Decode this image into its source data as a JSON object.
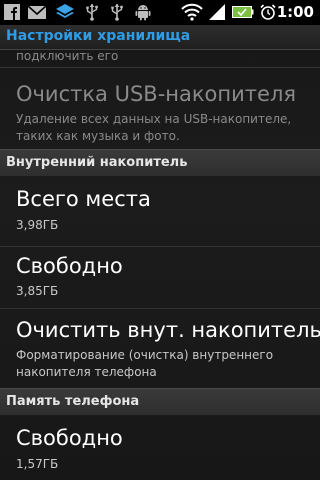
{
  "status_bar": {
    "time": "1:00",
    "icons": [
      "facebook-icon",
      "gmail-icon",
      "sync-icon",
      "usb-icon",
      "usb-icon",
      "android-icon",
      "wifi-icon",
      "battery-icon",
      "alarm-icon"
    ]
  },
  "title_bar": {
    "title": "Настройки хранилища"
  },
  "list": {
    "partial_summary": "подключить его",
    "clear_usb": {
      "title": "Очистка USB-накопителя",
      "summary_line1": "Удаление всех данных на USB-накопителе,",
      "summary_line2": "таких как музыка и фото."
    },
    "internal_header": "Внутренний накопитель",
    "total_space": {
      "title": "Всего места",
      "value": "3,98ГБ"
    },
    "free_internal": {
      "title": "Свободно",
      "value": "3,85ГБ"
    },
    "clear_internal": {
      "title": "Очистить внут. накопитель",
      "summary_line1": "Форматирование (очистка) внутреннего",
      "summary_line2": "накопителя телефона"
    },
    "phone_memory_header": "Память телефона",
    "free_phone": {
      "title": "Свободно",
      "value": "1,57ГБ"
    }
  },
  "colors": {
    "title_accent": "#2f9ce6",
    "disabled_text": "#8a8a8a",
    "status_bar_bg": "#000000"
  }
}
